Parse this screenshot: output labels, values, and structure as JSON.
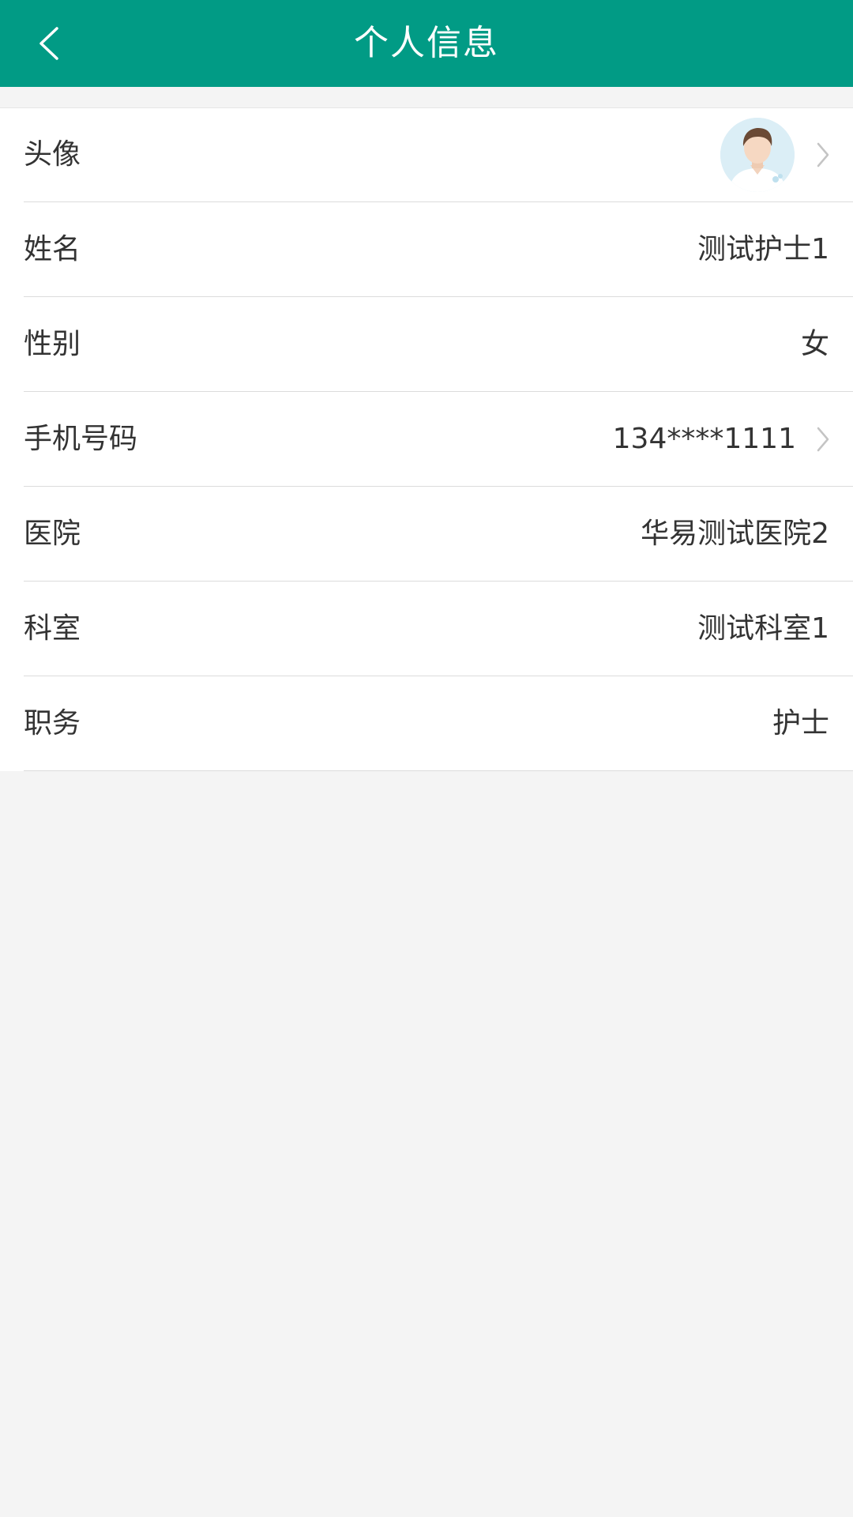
{
  "header": {
    "title": "个人信息",
    "back_icon": "chevron-left-icon",
    "bg_color": "#019b85"
  },
  "rows": [
    {
      "label": "头像",
      "value": "",
      "type": "avatar",
      "icon": "avatar-image"
    },
    {
      "label": "姓名",
      "value": "测试护士1"
    },
    {
      "label": "性别",
      "value": "女"
    },
    {
      "label": "手机号码",
      "value": "134****1111"
    },
    {
      "label": "医院",
      "value": "华易测试医院2"
    },
    {
      "label": "科室",
      "value": "测试科室1"
    },
    {
      "label": "职务",
      "value": "护士"
    }
  ]
}
